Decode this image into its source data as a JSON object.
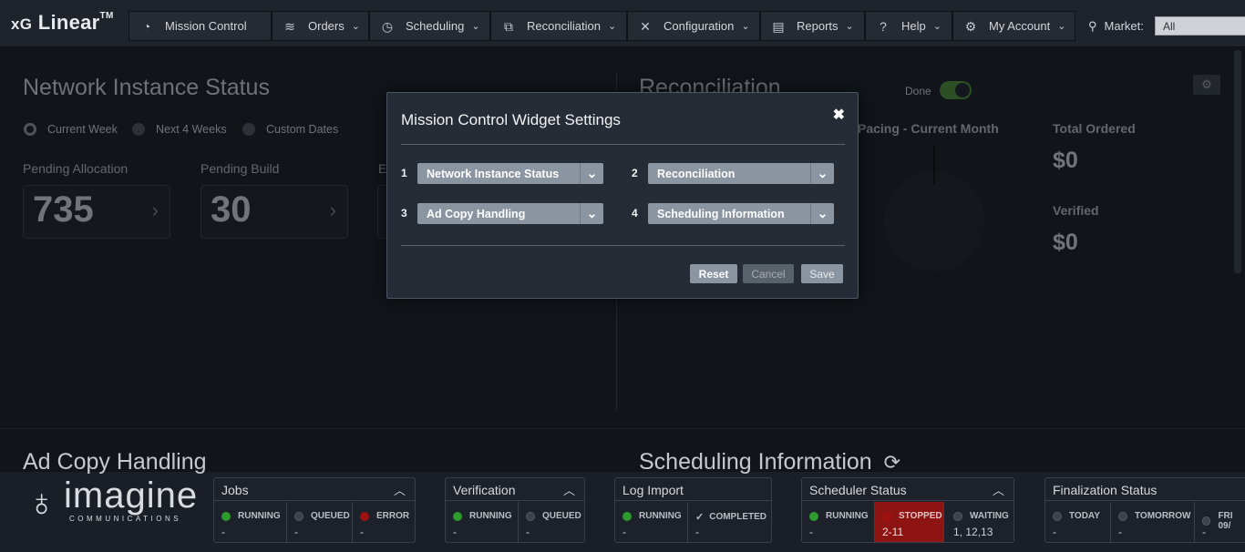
{
  "app": {
    "logo_pre": "xG",
    "logo_main": "Linear",
    "logo_tm": "TM"
  },
  "nav": [
    {
      "label": "Mission Control",
      "icon": "dashboard-icon"
    },
    {
      "label": "Orders",
      "icon": "database-icon"
    },
    {
      "label": "Scheduling",
      "icon": "clock-icon"
    },
    {
      "label": "Reconciliation",
      "icon": "reconcile-icon"
    },
    {
      "label": "Configuration",
      "icon": "tools-icon"
    },
    {
      "label": "Reports",
      "icon": "document-icon"
    },
    {
      "label": "Help",
      "icon": "question-icon"
    },
    {
      "label": "My Account",
      "icon": "gear-icon"
    }
  ],
  "market": {
    "label": "Market:",
    "value": "All"
  },
  "network_instance": {
    "title": "Network Instance Status",
    "radios": [
      "Current Week",
      "Next 4 Weeks",
      "Custom Dates"
    ],
    "stats": [
      {
        "label": "Pending Allocation",
        "value": "735"
      },
      {
        "label": "Pending Build",
        "value": "30"
      },
      {
        "label": "E",
        "value": ""
      }
    ]
  },
  "reconciliation": {
    "title": "Reconciliation",
    "done_label": "Done",
    "pacing_label": "Pacing - Current Month",
    "total_ordered_label": "Total Ordered",
    "total_ordered_value": "$0",
    "verified_label": "Verified",
    "verified_value": "$0"
  },
  "modal": {
    "title": "Mission Control Widget Settings",
    "close": "✖",
    "slots": [
      {
        "num": "1",
        "value": "Network Instance Status"
      },
      {
        "num": "2",
        "value": "Reconciliation"
      },
      {
        "num": "3",
        "value": "Ad Copy Handling"
      },
      {
        "num": "4",
        "value": "Scheduling Information"
      }
    ],
    "reset": "Reset",
    "cancel": "Cancel",
    "save": "Save"
  },
  "bottom": {
    "ad_copy_title": "Ad Copy Handling",
    "scheduling_title": "Scheduling Information",
    "logo_word": "imagine",
    "logo_sub": "COMMUNICATIONS"
  },
  "status": {
    "jobs": {
      "title": "Jobs",
      "cells": [
        {
          "label": "RUNNING",
          "led": "green",
          "value": "-"
        },
        {
          "label": "QUEUED",
          "led": "grey",
          "value": "-"
        },
        {
          "label": "ERROR",
          "led": "red",
          "value": "-"
        }
      ]
    },
    "verification": {
      "title": "Verification",
      "cells": [
        {
          "label": "RUNNING",
          "led": "green",
          "value": "-"
        },
        {
          "label": "QUEUED",
          "led": "grey",
          "value": "-"
        }
      ]
    },
    "log_import": {
      "title": "Log Import",
      "cells": [
        {
          "label": "RUNNING",
          "led": "green",
          "value": "-"
        },
        {
          "label": "COMPLETED",
          "led": "check",
          "value": "-"
        }
      ]
    },
    "scheduler": {
      "title": "Scheduler Status",
      "cells": [
        {
          "label": "RUNNING",
          "led": "green",
          "value": "-"
        },
        {
          "label": "STOPPED",
          "led": "red",
          "value": "2-11"
        },
        {
          "label": "WAITING",
          "led": "grey",
          "value": "1, 12,13"
        }
      ]
    },
    "finalization": {
      "title": "Finalization Status",
      "cells": [
        {
          "label": "TODAY",
          "led": "grey",
          "value": "-"
        },
        {
          "label": "TOMORROW",
          "led": "grey",
          "value": "-"
        },
        {
          "label": "FRI 09/",
          "led": "grey",
          "value": "-"
        }
      ]
    }
  },
  "colors": {
    "accent_green": "#2d9b2d",
    "error_red": "#a01212",
    "modal_bg": "#262c35"
  }
}
